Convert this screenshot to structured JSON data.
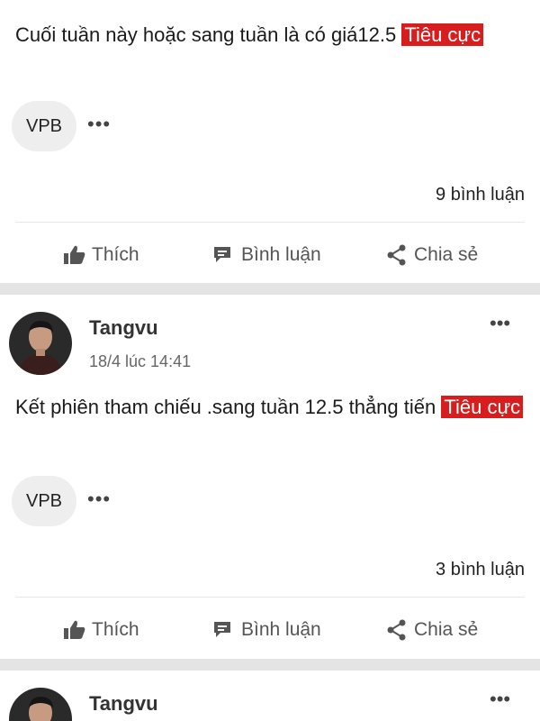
{
  "posts": [
    {
      "content": "Cuối tuần này hoặc sang tuần là có giá12.5",
      "tag": "Tiêu cực",
      "stock": "VPB",
      "comments": "9 bình luận",
      "actions": {
        "like": "Thích",
        "comment": "Bình luận",
        "share": "Chia sẻ"
      }
    },
    {
      "author": "Tangvu",
      "time": "18/4 lúc 14:41",
      "content": "Kết phiên tham chiếu .sang tuần 12.5 thẳng tiến",
      "tag": "Tiêu cực",
      "stock": "VPB",
      "comments": "3 bình luận",
      "actions": {
        "like": "Thích",
        "comment": "Bình luận",
        "share": "Chia sẻ"
      }
    },
    {
      "author": "Tangvu"
    }
  ],
  "icons": {
    "more": "more-horizontal-icon",
    "like": "thumbs-up-icon",
    "comment": "comment-icon",
    "share": "share-icon"
  },
  "colors": {
    "tag_bg": "#d71d1d",
    "divider": "#e4e4e4",
    "chip_bg": "#eeeeee"
  }
}
